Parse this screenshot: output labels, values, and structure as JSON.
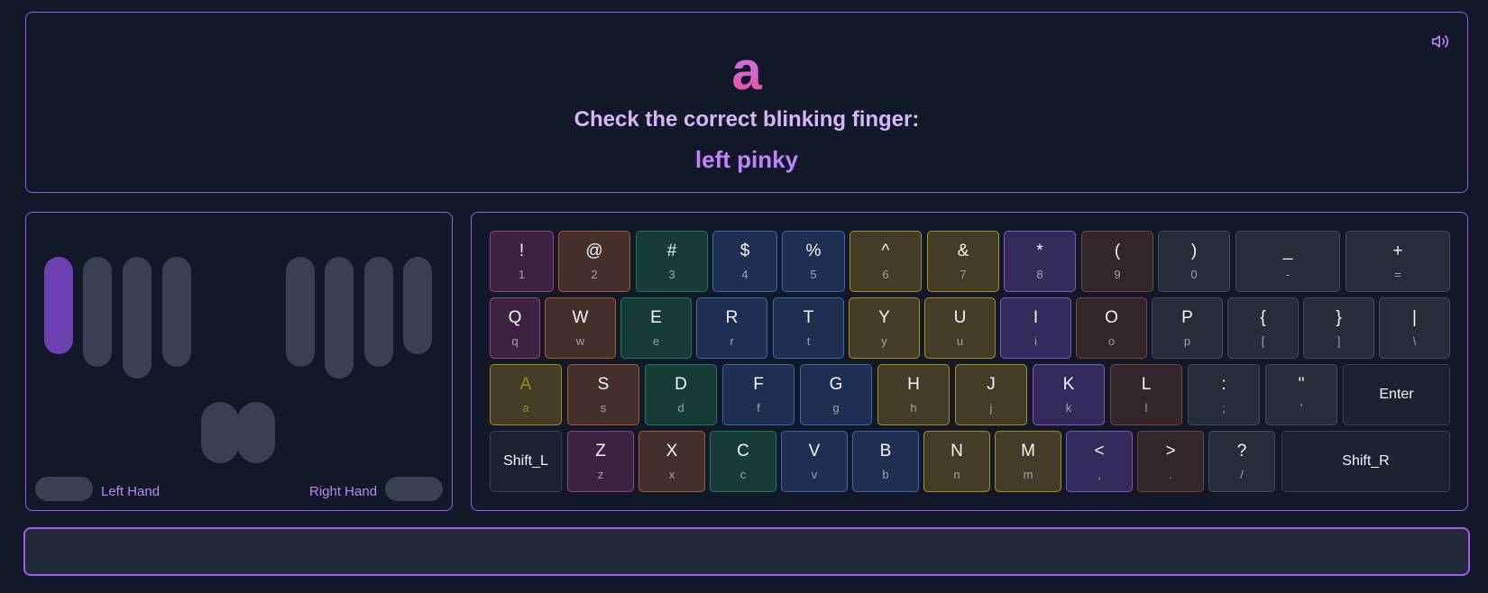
{
  "prompt": {
    "target_char": "a",
    "instruction": "Check the correct blinking finger:",
    "finger": "left pinky"
  },
  "hands": {
    "left_label": "Left Hand",
    "right_label": "Right Hand",
    "active_finger": "left-pinky"
  },
  "colors": {
    "accent": "#8b5cf6",
    "active_finger": "#6d3fb0",
    "highlight_key": "#a3891f"
  },
  "keyboard": {
    "rows": [
      [
        {
          "upper": "!",
          "lower": "1"
        },
        {
          "upper": "@",
          "lower": "2"
        },
        {
          "upper": "#",
          "lower": "3"
        },
        {
          "upper": "$",
          "lower": "4"
        },
        {
          "upper": "%",
          "lower": "5"
        },
        {
          "upper": "^",
          "lower": "6"
        },
        {
          "upper": "&",
          "lower": "7"
        },
        {
          "upper": "*",
          "lower": "8"
        },
        {
          "upper": "(",
          "lower": "9"
        },
        {
          "upper": ")",
          "lower": "0"
        },
        {
          "upper": "_",
          "lower": "-"
        },
        {
          "upper": "+",
          "lower": "="
        }
      ],
      [
        {
          "upper": "Q",
          "lower": "q"
        },
        {
          "upper": "W",
          "lower": "w"
        },
        {
          "upper": "E",
          "lower": "e"
        },
        {
          "upper": "R",
          "lower": "r"
        },
        {
          "upper": "T",
          "lower": "t"
        },
        {
          "upper": "Y",
          "lower": "y"
        },
        {
          "upper": "U",
          "lower": "u"
        },
        {
          "upper": "I",
          "lower": "i"
        },
        {
          "upper": "O",
          "lower": "o"
        },
        {
          "upper": "P",
          "lower": "p"
        },
        {
          "upper": "{",
          "lower": "["
        },
        {
          "upper": "}",
          "lower": "]"
        },
        {
          "upper": "|",
          "lower": "\\"
        }
      ],
      [
        {
          "upper": "A",
          "lower": "a"
        },
        {
          "upper": "S",
          "lower": "s"
        },
        {
          "upper": "D",
          "lower": "d"
        },
        {
          "upper": "F",
          "lower": "f"
        },
        {
          "upper": "G",
          "lower": "g"
        },
        {
          "upper": "H",
          "lower": "h"
        },
        {
          "upper": "J",
          "lower": "j"
        },
        {
          "upper": "K",
          "lower": "k"
        },
        {
          "upper": "L",
          "lower": "l"
        },
        {
          "upper": ":",
          "lower": ";"
        },
        {
          "upper": "\"",
          "lower": "'"
        },
        {
          "upper": "Enter"
        }
      ],
      [
        {
          "upper": "Shift_L"
        },
        {
          "upper": "Z",
          "lower": "z"
        },
        {
          "upper": "X",
          "lower": "x"
        },
        {
          "upper": "C",
          "lower": "c"
        },
        {
          "upper": "V",
          "lower": "v"
        },
        {
          "upper": "B",
          "lower": "b"
        },
        {
          "upper": "N",
          "lower": "n"
        },
        {
          "upper": "M",
          "lower": "m"
        },
        {
          "upper": "<",
          "lower": ","
        },
        {
          "upper": ">",
          "lower": "."
        },
        {
          "upper": "?",
          "lower": "/"
        },
        {
          "upper": "Shift_R"
        }
      ]
    ]
  },
  "input": {
    "value": ""
  }
}
